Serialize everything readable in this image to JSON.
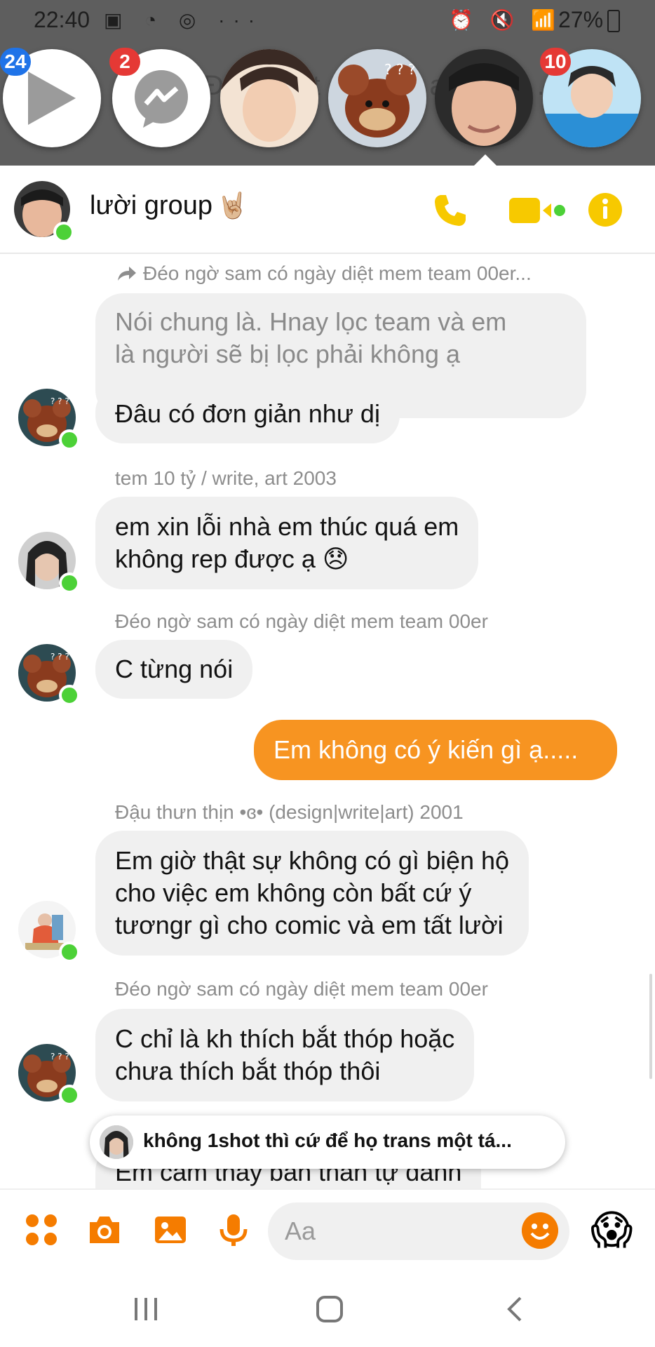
{
  "status_bar": {
    "time": "22:40",
    "left_icons": "▣ ◔ ◎ ···",
    "right_icons": "⏰ 🔇 📶",
    "battery": "27%"
  },
  "chat_heads": [
    {
      "name": "play",
      "badge": "24",
      "badge_color": "#1f73e8"
    },
    {
      "name": "messenger",
      "badge": "2",
      "badge_color": "#e53935"
    },
    {
      "name": "contact-3",
      "badge": ""
    },
    {
      "name": "contact-4",
      "badge": ""
    },
    {
      "name": "contact-5-active",
      "badge": ""
    },
    {
      "name": "contact-6",
      "badge": "10",
      "badge_color": "#e53935"
    }
  ],
  "header": {
    "title": "lười group",
    "title_emoji": "🤘🏼",
    "accent_color": "#f7c900"
  },
  "messages": {
    "m1_sender": "Đéo ngờ sam có ngày diệt mem team 00er...",
    "m1_line1": "Nói chung là. Hnay lọc team và em",
    "m1_line2": "là người sẽ bị lọc phải không ạ",
    "m2": "Đâu có đơn giản như dị",
    "m3_sender": "tem 10 tỷ / write, art 2003",
    "m3_line1": "em xin lỗi nhà em thúc quá em",
    "m3_line2": "không rep được ạ 😞",
    "m4_sender": "Đéo ngờ sam có ngày diệt mem team 00er",
    "m4": "C từng nói",
    "m5_own": "Em không có ý kiến gì ạ.....",
    "m6_sender": "Đậu thưn thịn •ɞ•  (design|write|art) 2001",
    "m6_line1": "Em giờ thật sự không có gì biện hộ",
    "m6_line2": "cho việc em không còn bất cứ ý",
    "m6_line3": "tươngr gì cho comic và em tất lười",
    "m7_sender": "Đéo ngờ sam có ngày diệt mem team 00er",
    "m7_line1": "C chỉ là kh thích bắt thóp hoặc",
    "m7_line2": "chưa thích bắt thóp thôi",
    "m8_partial": "Em cảm thấy bản thân tự đánh"
  },
  "toast": {
    "text": "không 1shot thì cứ để họ trans một tá..."
  },
  "composer": {
    "placeholder": "Aa",
    "accent_color": "#f57c00"
  }
}
